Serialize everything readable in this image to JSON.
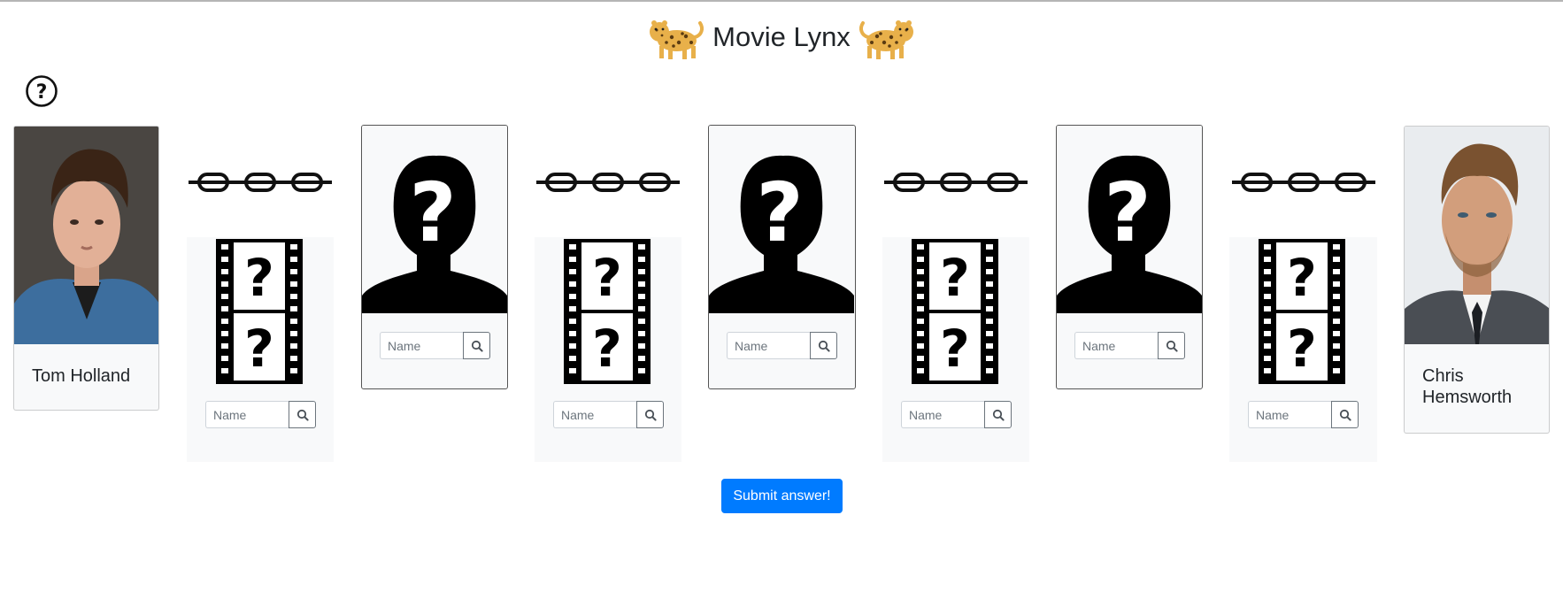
{
  "header": {
    "title": "Movie Lynx",
    "left_icon": "leopard-emoji",
    "right_icon": "leopard-emoji"
  },
  "help": {
    "icon": "question-circle-icon"
  },
  "start_actor": {
    "name": "Tom Holland"
  },
  "end_actor": {
    "name": "Chris Hemsworth"
  },
  "unknown_actors": [
    {
      "icon": "unknown-person-icon",
      "placeholder": "Name"
    },
    {
      "icon": "unknown-person-icon",
      "placeholder": "Name"
    },
    {
      "icon": "unknown-person-icon",
      "placeholder": "Name"
    }
  ],
  "unknown_movies": [
    {
      "icon": "unknown-film-icon",
      "placeholder": "Name"
    },
    {
      "icon": "unknown-film-icon",
      "placeholder": "Name"
    },
    {
      "icon": "unknown-film-icon",
      "placeholder": "Name"
    },
    {
      "icon": "unknown-film-icon",
      "placeholder": "Name"
    }
  ],
  "links": {
    "icon": "chain-link-icon"
  },
  "submit": {
    "label": "Submit answer!"
  },
  "colors": {
    "primary": "#007bff",
    "card_bg": "#f8f9fa",
    "text": "#212529"
  }
}
